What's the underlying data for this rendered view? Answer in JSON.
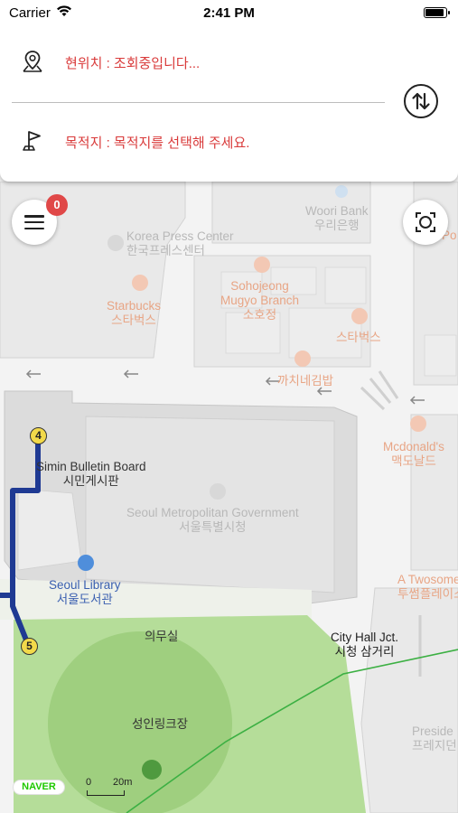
{
  "status_bar": {
    "carrier": "Carrier",
    "time": "2:41 PM"
  },
  "route_panel": {
    "current_location": "현위치 : 조회중입니다...",
    "destination": "목적지 : 목적지를 선택해 주세요.",
    "text_color": "#d93a3a"
  },
  "menu": {
    "badge_count": "0",
    "badge_color": "#e04848"
  },
  "map": {
    "labels": {
      "woori_en": "Woori Bank",
      "woori_ko": "우리은행",
      "korea_press_en": "Korea Press Center",
      "korea_press_ko": "한국프레스센터",
      "starbucks1_en": "Starbucks",
      "starbucks1_ko": "스타벅스",
      "sohojeong_en": "Sohojeong",
      "sohojeong_en2": "Mugyo Branch",
      "sohojeong_ko": "소호정",
      "starbucks2_ko": "스타벅스",
      "kka_ko": "까치네김밥",
      "mcdonalds_en": "Mcdonald's",
      "mcdonalds_ko": "맥도날드",
      "simin_en": "Simin Bulletin Board",
      "simin_ko": "시민게시판",
      "seoul_gov_en": "Seoul Metropolitan Government",
      "seoul_gov_ko": "서울특별시청",
      "library_en": "Seoul Library",
      "library_ko": "서울도서관",
      "twosome_en": "A Twosome Place",
      "twosome_ko": "투썸플레이스",
      "medical_ko": "의무실",
      "city_hall_en": "City Hall Jct.",
      "city_hall_ko": "시청 삼거리",
      "rink_ko": "성인링크장",
      "president_en": "Preside",
      "president_ko": "프레지던",
      "po": "Po"
    },
    "exits": [
      "4",
      "5"
    ],
    "route_color": "#1f3a93",
    "subway_line_color": "#3cb043",
    "park_color": "#b5dd99",
    "naver_logo": "NAVER",
    "scale_zero": "0",
    "scale_label": "20m"
  }
}
